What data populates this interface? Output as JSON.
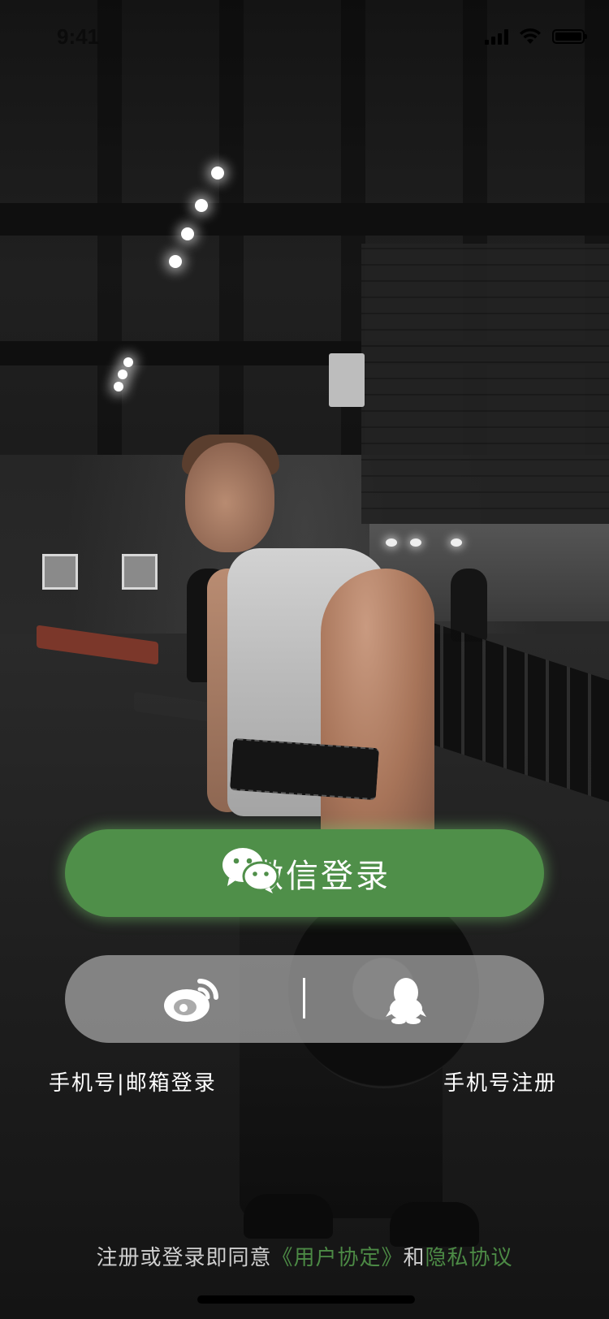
{
  "status_bar": {
    "time": "9:41"
  },
  "login": {
    "wechat_label": "微信登录",
    "phone_email_login": "手机号|邮箱登录",
    "phone_register": "手机号注册"
  },
  "agreement": {
    "prefix": "注册或登录即同意",
    "user_agreement": "《用户协定》",
    "and": "和",
    "privacy_policy": "隐私协议"
  },
  "icons": {
    "wechat": "wechat-icon",
    "weibo": "weibo-icon",
    "qq": "qq-icon"
  },
  "colors": {
    "accent_green": "#4f8f49",
    "link_green": "#4c8a45",
    "social_bar": "#aaaaaa"
  }
}
